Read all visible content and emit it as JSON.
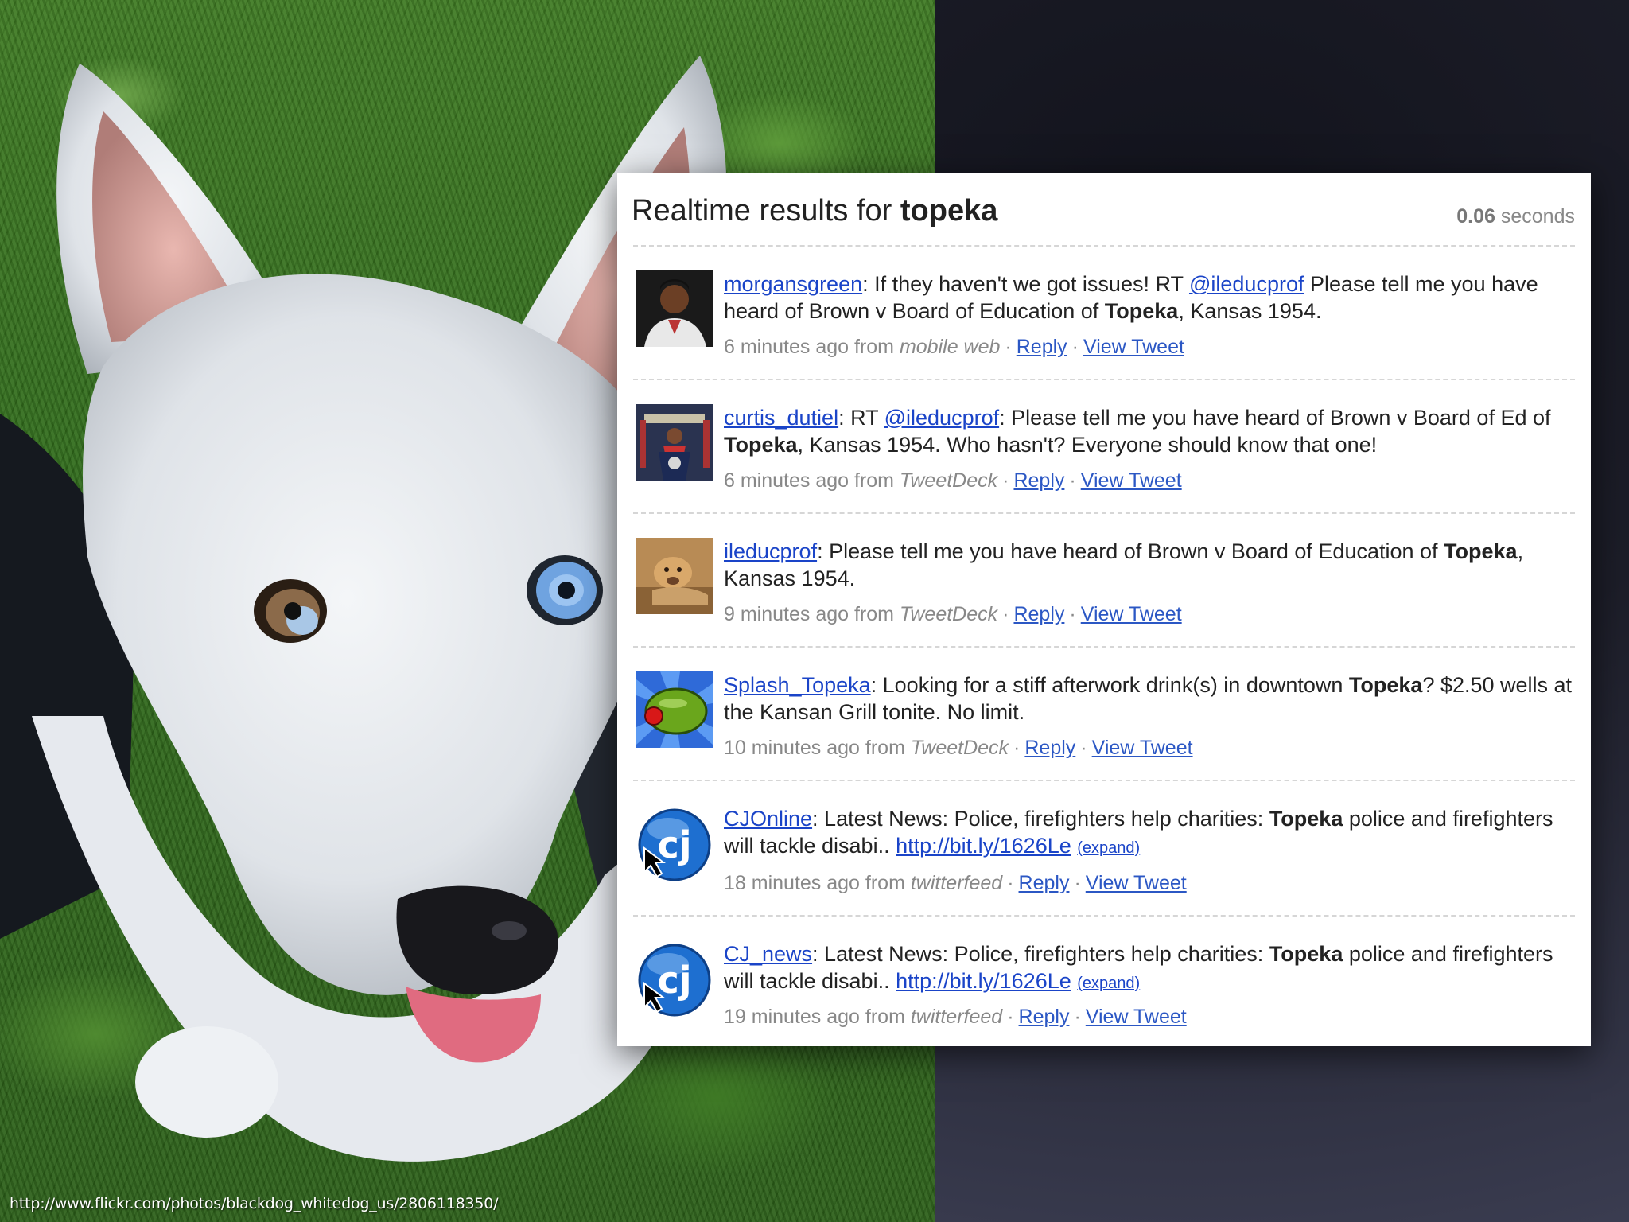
{
  "photo_credit": "http://www.flickr.com/photos/blackdog_whitedog_us/2806118350/",
  "header": {
    "title_prefix": "Realtime results for",
    "query": "topeka",
    "time_value": "0.06",
    "time_unit": "seconds"
  },
  "tweets": [
    {
      "user": "morgansgreen",
      "avatar": "person-photo-avatar",
      "t1": ": If they haven't we got issues! RT ",
      "mention": "@ileducprof",
      "t2": " Please tell me you have heard of Brown v Board of Education of ",
      "kw": "Topeka",
      "t3": ", Kansas 1954.",
      "time": "6 minutes ago from",
      "source": "mobile web",
      "reply": "Reply",
      "view": "View Tweet"
    },
    {
      "user": "curtis_dutiel",
      "avatar": "podium-speaker-avatar",
      "t1": ": RT ",
      "mention": "@ileducprof",
      "t2": ": Please tell me you have heard of Brown v Board of Ed of ",
      "kw": "Topeka",
      "t3": ", Kansas 1954. Who hasn't? Everyone should know that one!",
      "time": "6 minutes ago from",
      "source": "TweetDeck",
      "reply": "Reply",
      "view": "View Tweet"
    },
    {
      "user": "ileducprof",
      "avatar": "lion-avatar",
      "t1": ": Please tell me you have heard of Brown v Board of Education of ",
      "kw": "Topeka",
      "t3": ", Kansas 1954.",
      "time": "9 minutes ago from",
      "source": "TweetDeck",
      "reply": "Reply",
      "view": "View Tweet"
    },
    {
      "user": "Splash_Topeka",
      "avatar": "olive-avatar",
      "t1": ": Looking for a stiff afterwork drink(s) in downtown ",
      "kw": "Topeka",
      "t3": "? $2.50 wells at the Kansan Grill tonite. No limit.",
      "time": "10 minutes ago from",
      "source": "TweetDeck",
      "reply": "Reply",
      "view": "View Tweet"
    },
    {
      "user": "CJOnline",
      "avatar": "cj-logo-avatar",
      "t1": ": Latest News: Police, firefighters help charities: ",
      "kw": "Topeka",
      "t3": " police and firefighters will tackle disabi.. ",
      "link": "http://bit.ly/1626Le",
      "expand": "(expand)",
      "time": "18 minutes ago from",
      "source": "twitterfeed",
      "reply": "Reply",
      "view": "View Tweet"
    },
    {
      "user": "CJ_news",
      "avatar": "cj-logo-avatar",
      "t1": ": Latest News: Police, firefighters help charities: ",
      "kw": "Topeka",
      "t3": " police and firefighters will tackle disabi.. ",
      "link": "http://bit.ly/1626Le",
      "expand": "(expand)",
      "time": "19 minutes ago from",
      "source": "twitterfeed",
      "reply": "Reply",
      "view": "View Tweet"
    }
  ]
}
